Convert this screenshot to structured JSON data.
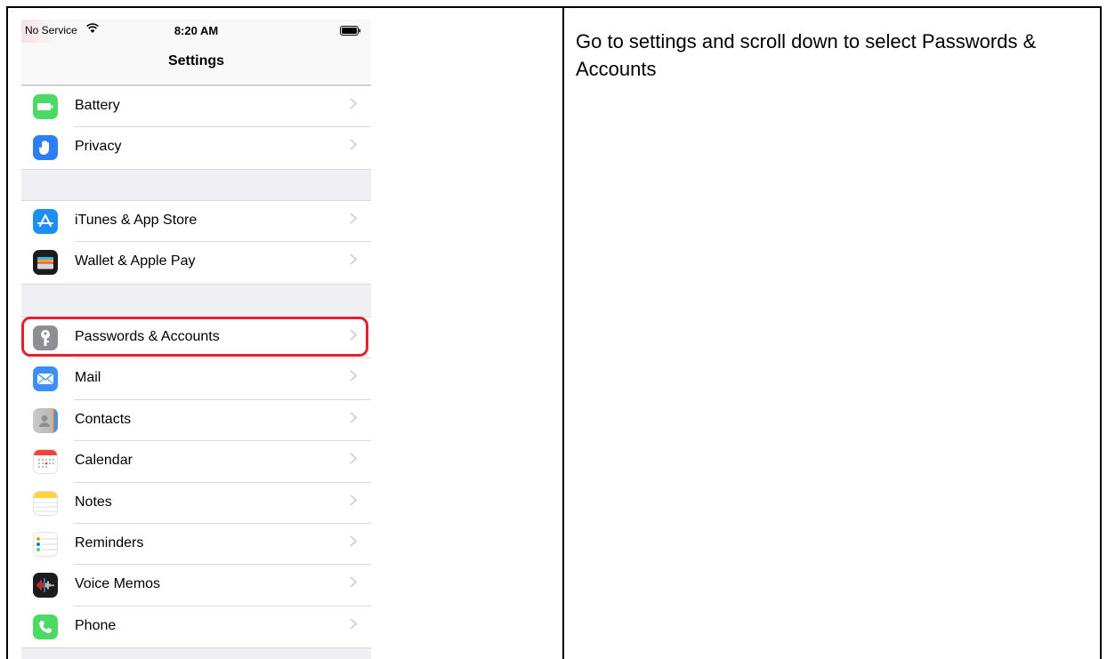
{
  "status_bar": {
    "carrier": "No Service",
    "time": "8:20 AM"
  },
  "nav": {
    "title": "Settings"
  },
  "groups": [
    {
      "items": [
        {
          "label": "Battery",
          "icon": "battery-app-icon",
          "color": "#4cd964"
        },
        {
          "label": "Privacy",
          "icon": "hand-icon",
          "color": "#2e7cf6"
        }
      ]
    },
    {
      "items": [
        {
          "label": "iTunes & App Store",
          "icon": "app-store-icon",
          "color": "#1d8ff3"
        },
        {
          "label": "Wallet & Apple Pay",
          "icon": "wallet-icon",
          "color": "#1c1c1e"
        }
      ]
    },
    {
      "items": [
        {
          "label": "Passwords & Accounts",
          "icon": "key-icon",
          "color": "#8e8e93"
        },
        {
          "label": "Mail",
          "icon": "mail-icon",
          "color": "#3d8ef7"
        },
        {
          "label": "Contacts",
          "icon": "contacts-icon",
          "color": "#b8b8b8"
        },
        {
          "label": "Calendar",
          "icon": "calendar-icon",
          "color": "#ffffff"
        },
        {
          "label": "Notes",
          "icon": "notes-icon",
          "color": "#ffd43b"
        },
        {
          "label": "Reminders",
          "icon": "reminders-icon",
          "color": "#ffffff"
        },
        {
          "label": "Voice Memos",
          "icon": "voice-memos-icon",
          "color": "#1c1c1e"
        },
        {
          "label": "Phone",
          "icon": "phone-icon",
          "color": "#4cd964"
        }
      ]
    }
  ],
  "highlight_color": "#e3202f",
  "instruction": "Go to settings and scroll down to select Passwords & Accounts"
}
